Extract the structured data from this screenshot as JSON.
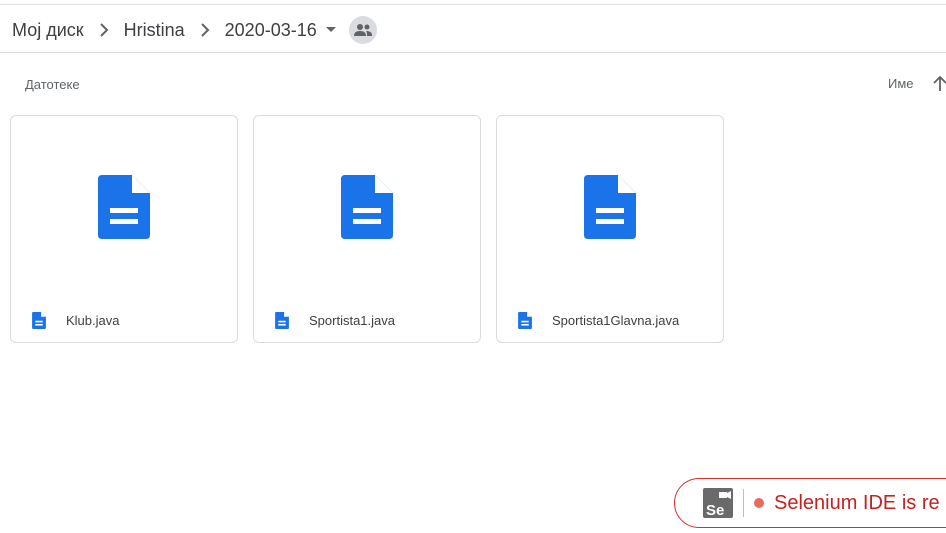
{
  "breadcrumb": {
    "items": [
      {
        "label": "Мој диск"
      },
      {
        "label": "Hristina"
      },
      {
        "label": "2020-03-16"
      }
    ]
  },
  "list": {
    "section_label": "Датотеке",
    "sort_label": "Име",
    "sort_direction": "ascending"
  },
  "files": [
    {
      "name": "Klub.java",
      "icon": "docs-icon"
    },
    {
      "name": "Sportista1.java",
      "icon": "docs-icon"
    },
    {
      "name": "Sportista1Glavna.java",
      "icon": "docs-icon"
    }
  ],
  "toast": {
    "logo_text": "Se",
    "text": "Selenium IDE is re"
  },
  "colors": {
    "docs_blue": "#1a73e8",
    "toast_red": "#c5221f",
    "border": "#dadce0"
  }
}
